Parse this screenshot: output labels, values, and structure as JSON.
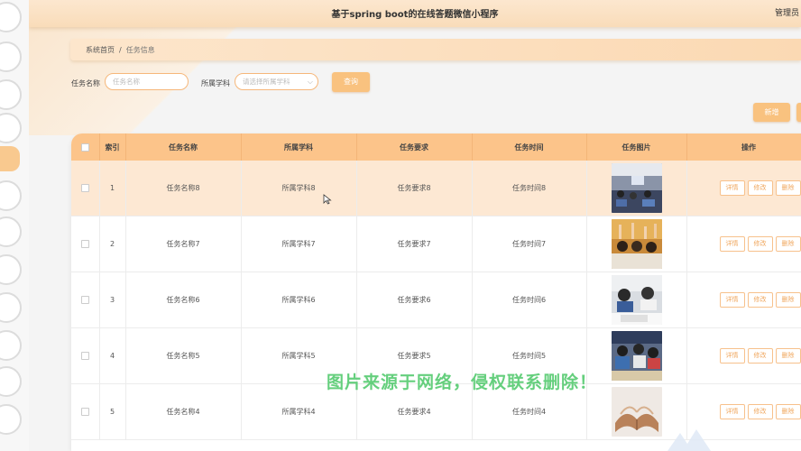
{
  "header": {
    "title": "基于spring boot的在线答题微信小程序",
    "admin": "管理员"
  },
  "breadcrumb": {
    "home": "系统首页",
    "separator": "/",
    "current": "任务信息"
  },
  "search": {
    "name_label": "任务名称",
    "name_placeholder": "任务名称",
    "subject_label": "所属学科",
    "subject_placeholder": "请选择所属学科",
    "search_button": "查询"
  },
  "actions": {
    "add_button": "新增"
  },
  "table": {
    "headers": [
      "索引",
      "任务名称",
      "所属学科",
      "任务要求",
      "任务时间",
      "任务图片",
      "操作"
    ],
    "rows": [
      {
        "index": "1",
        "name": "任务名称8",
        "subject": "所属学科8",
        "requirement": "任务要求8",
        "time": "任务时间8"
      },
      {
        "index": "2",
        "name": "任务名称7",
        "subject": "所属学科7",
        "requirement": "任务要求7",
        "time": "任务时间7"
      },
      {
        "index": "3",
        "name": "任务名称6",
        "subject": "所属学科6",
        "requirement": "任务要求6",
        "time": "任务时间6"
      },
      {
        "index": "4",
        "name": "任务名称5",
        "subject": "所属学科5",
        "requirement": "任务要求5",
        "time": "任务时间5"
      },
      {
        "index": "5",
        "name": "任务名称4",
        "subject": "所属学科4",
        "requirement": "任务要求4",
        "time": "任务时间4"
      }
    ],
    "row_buttons": {
      "detail": "详情",
      "edit": "修改",
      "delete": "删除"
    }
  },
  "watermark": "图片来源于网络，侵权联系删除！",
  "colors": {
    "accent": "#fcc48a",
    "accent_dark": "#f6b77a",
    "highlight_row": "#fde8d3",
    "watermark": "#59cc73"
  }
}
